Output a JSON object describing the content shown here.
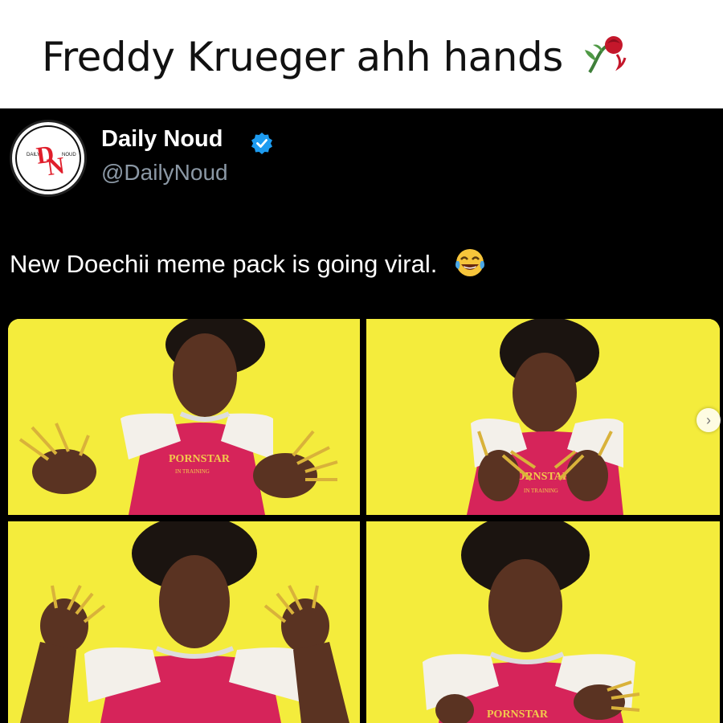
{
  "caption": {
    "text": "Freddy Krueger ahh hands",
    "emoji": "wilted-rose-icon"
  },
  "tweet": {
    "display_name": "Daily Noud",
    "handle": "@DailyNoud",
    "verified": true,
    "avatar": {
      "initials": "DN",
      "left_text": "DAILY",
      "right_text": "NOUD",
      "accent_color": "#e01e2b"
    },
    "text": "New Doechii meme pack is going viral.",
    "emoji": "face-with-tears-of-joy-icon",
    "shirt_text": "PORNSTAR",
    "shirt_subtext": "IN TRAINING",
    "images": [
      {
        "pose": "hands-spread-eyes-closed"
      },
      {
        "pose": "pointing-at-self"
      },
      {
        "pose": "hands-raised-claws"
      },
      {
        "pose": "smiling-hands-low"
      }
    ]
  },
  "colors": {
    "tweet_background": "#000000",
    "handle_gray": "#8b98a5",
    "verified_blue": "#1d9bf0",
    "image_background": "#f4ec3c",
    "shirt_pink": "#d6245a"
  }
}
